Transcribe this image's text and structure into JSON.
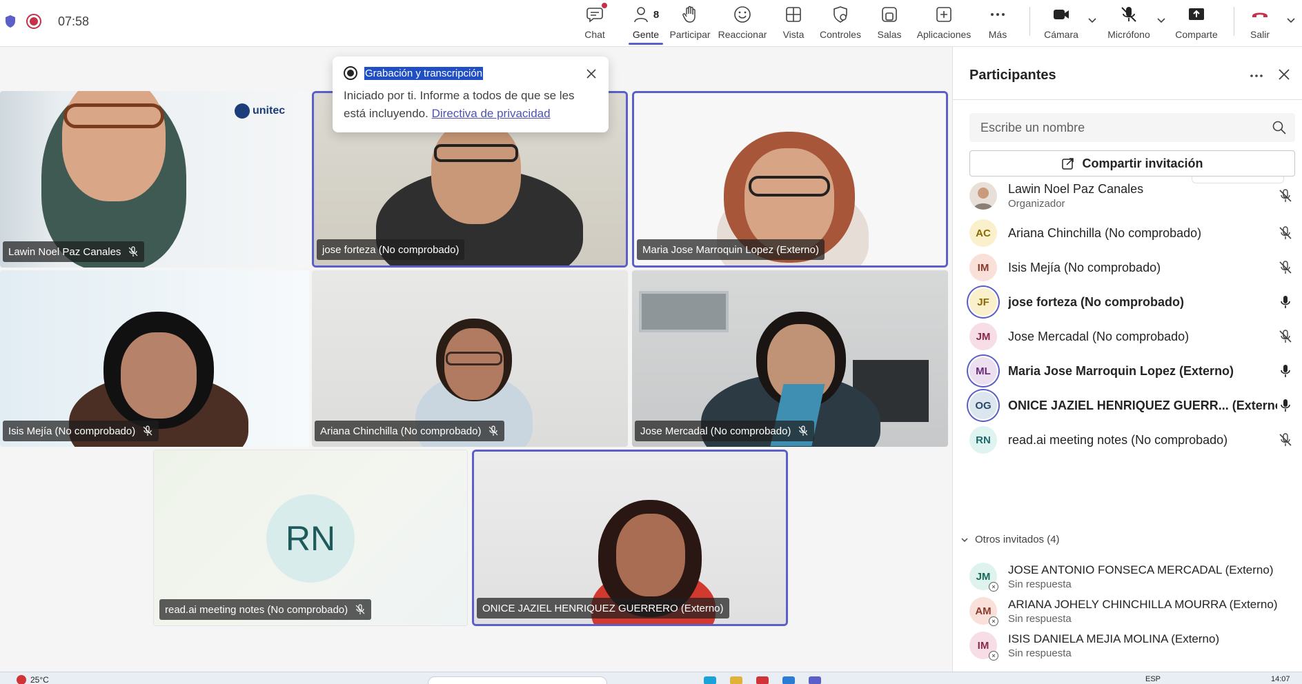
{
  "meeting": {
    "timer": "07:58"
  },
  "toolbar": {
    "chat": "Chat",
    "people": "Gente",
    "people_count": "8",
    "raise": "Participar",
    "react": "Reaccionar",
    "view": "Vista",
    "controls": "Controles",
    "rooms": "Salas",
    "apps": "Aplicaciones",
    "more": "Más",
    "camera": "Cámara",
    "mic": "Micrófono",
    "share": "Comparte",
    "leave": "Salir"
  },
  "popup": {
    "title": "Grabación y transcripción",
    "body": "Iniciado por ti. Informe a todos de que se les está incluyendo.",
    "link": "Directiva de privacidad"
  },
  "tiles": [
    {
      "name": "Lawin Noel Paz Canales",
      "muted": true
    },
    {
      "name": "jose forteza (No comprobado)",
      "muted": false
    },
    {
      "name": "Maria Jose Marroquin Lopez (Externo)",
      "muted": false
    },
    {
      "name": "Isis Mejía (No comprobado)",
      "muted": true
    },
    {
      "name": "Ariana Chinchilla (No comprobado)",
      "muted": true
    },
    {
      "name": "Jose Mercadal (No comprobado)",
      "muted": true
    },
    {
      "name": "read.ai meeting notes (No comprobado)",
      "muted": true,
      "initials": "RN"
    },
    {
      "name": "ONICE JAZIEL HENRIQUEZ GUERRERO (Externo)",
      "muted": false
    }
  ],
  "tile_logo": "unitec",
  "panel": {
    "title": "Participantes",
    "search_placeholder": "Escribe un nombre",
    "share_invite": "Compartir invitación",
    "participants": [
      {
        "initials": "",
        "name": "Lawin Noel Paz Canales",
        "sub": "Organizador",
        "muted": true,
        "bold": false,
        "color": "#e8e0d8",
        "text": "#5a4a3a"
      },
      {
        "initials": "AC",
        "name": "Ariana Chinchilla (No comprobado)",
        "sub": "",
        "muted": true,
        "bold": false,
        "color": "#fbf0cc",
        "text": "#8a6a00"
      },
      {
        "initials": "IM",
        "name": "Isis Mejía (No comprobado)",
        "sub": "",
        "muted": true,
        "bold": false,
        "color": "#f9e0d9",
        "text": "#8a3a2a"
      },
      {
        "initials": "JF",
        "name": "jose forteza (No comprobado)",
        "sub": "",
        "muted": false,
        "bold": true,
        "color": "#fbf0cc",
        "text": "#8a6a00"
      },
      {
        "initials": "JM",
        "name": "Jose Mercadal (No comprobado)",
        "sub": "",
        "muted": true,
        "bold": false,
        "color": "#f6dde6",
        "text": "#8a2a4a"
      },
      {
        "initials": "ML",
        "name": "Maria Jose Marroquin Lopez (Externo)",
        "sub": "",
        "muted": false,
        "bold": true,
        "color": "#ecdff0",
        "text": "#6a2a7a"
      },
      {
        "initials": "OG",
        "name": "ONICE JAZIEL HENRIQUEZ GUERR... (Externo)",
        "sub": "",
        "muted": false,
        "bold": true,
        "color": "#dbe6ee",
        "text": "#2a4a6a"
      },
      {
        "initials": "RN",
        "name": "read.ai meeting notes (No comprobado)",
        "sub": "",
        "muted": true,
        "bold": false,
        "color": "#dff3f1",
        "text": "#1a6a6a"
      }
    ],
    "others_label": "Otros invitados (4)",
    "others": [
      {
        "initials": "JM",
        "name": "JOSE ANTONIO FONSECA MERCADAL (Externo)",
        "sub": "Sin respuesta",
        "color": "#dff3ee",
        "text": "#1a6a5a"
      },
      {
        "initials": "AM",
        "name": "ARIANA JOHELY CHINCHILLA MOURRA (Externo)",
        "sub": "Sin respuesta",
        "color": "#f9e0d9",
        "text": "#8a3a2a"
      },
      {
        "initials": "IM",
        "name": "ISIS DANIELA MEJIA MOLINA (Externo)",
        "sub": "Sin respuesta",
        "color": "#f6dde6",
        "text": "#8a2a4a"
      }
    ]
  },
  "taskbar": {
    "weather": "25°C",
    "lang": "ESP",
    "time": "14:07"
  },
  "colors": {
    "accent": "#5b5fc7",
    "leave": "#c4314b",
    "recording": "#c4314b"
  }
}
